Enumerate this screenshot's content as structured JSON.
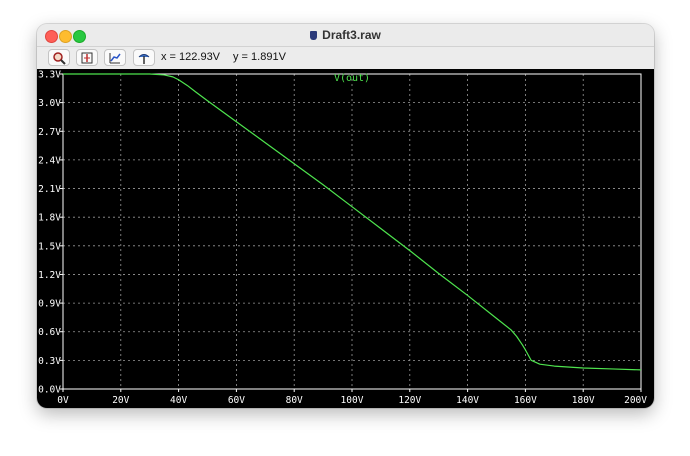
{
  "window": {
    "title": "Draft3.raw"
  },
  "toolbar": {
    "x_readout": "x = 122.93V",
    "y_readout": "y = 1.891V"
  },
  "colors": {
    "plot_bg": "#000000",
    "grid": "#9a9a9a",
    "trace": "#4ee44e",
    "axis_text": "#ffffff"
  },
  "icons": {
    "zoom": "magnifier-icon",
    "autorange": "autorange-icon",
    "fit": "fit-axis-icon",
    "cursor": "probe-icon"
  },
  "chart_data": {
    "type": "line",
    "title": "V(out)",
    "xlim": [
      0,
      200
    ],
    "ylim": [
      0,
      3.3
    ],
    "grid": true,
    "x_ticks": [
      "0V",
      "20V",
      "40V",
      "60V",
      "80V",
      "100V",
      "120V",
      "140V",
      "160V",
      "180V",
      "200V"
    ],
    "y_ticks": [
      "0.0V",
      "0.3V",
      "0.6V",
      "0.9V",
      "1.2V",
      "1.5V",
      "1.8V",
      "2.1V",
      "2.4V",
      "2.7V",
      "3.0V",
      "3.3V"
    ],
    "series": [
      {
        "name": "V(out)",
        "x": [
          0,
          10,
          20,
          30,
          35,
          38,
          40,
          43,
          46,
          50,
          55,
          60,
          70,
          80,
          90,
          100,
          110,
          120,
          130,
          140,
          150,
          155,
          157,
          159,
          160,
          162,
          165,
          170,
          180,
          190,
          200
        ],
        "y": [
          3.3,
          3.3,
          3.3,
          3.3,
          3.29,
          3.27,
          3.24,
          3.18,
          3.11,
          3.02,
          2.91,
          2.8,
          2.58,
          2.36,
          2.14,
          1.91,
          1.68,
          1.45,
          1.21,
          0.98,
          0.74,
          0.62,
          0.55,
          0.46,
          0.41,
          0.3,
          0.26,
          0.24,
          0.22,
          0.21,
          0.2
        ]
      }
    ]
  }
}
